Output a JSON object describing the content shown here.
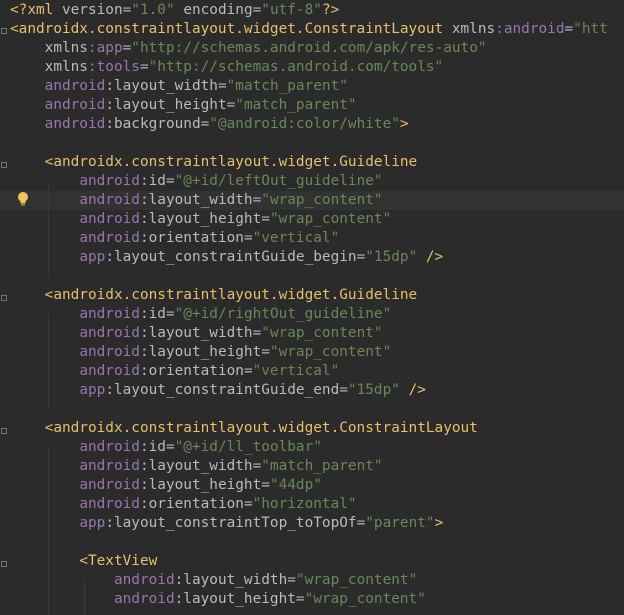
{
  "editor": {
    "lines": [
      {
        "text": "<?xml version=\"1.0\" encoding=\"utf-8\"?>",
        "segments": [
          [
            "pi",
            "<?xml "
          ],
          [
            "att",
            "version"
          ],
          [
            "pun",
            "="
          ],
          [
            "val",
            "\"1.0\""
          ],
          [
            "pun",
            " "
          ],
          [
            "att",
            "encoding"
          ],
          [
            "pun",
            "="
          ],
          [
            "val",
            "\"utf-8\""
          ],
          [
            "pi",
            "?>"
          ]
        ]
      },
      {
        "text": "<androidx.constraintlayout.widget.ConstraintLayout xmlns:android=\"htt",
        "segments": [
          [
            "tag",
            "<androidx.constraintlayout.widget.ConstraintLayout "
          ],
          [
            "att",
            "xmlns"
          ],
          [
            "ns",
            ":android"
          ],
          [
            "pun",
            "="
          ],
          [
            "val",
            "\"htt"
          ]
        ]
      },
      {
        "text": "    xmlns:app=\"http://schemas.android.com/apk/res-auto\"",
        "segments": [
          [
            "pun",
            "    "
          ],
          [
            "att",
            "xmlns"
          ],
          [
            "ns",
            ":app"
          ],
          [
            "pun",
            "="
          ],
          [
            "val",
            "\"http://schemas.android.com/apk/res-auto\""
          ]
        ]
      },
      {
        "text": "    xmlns:tools=\"http://schemas.android.com/tools\"",
        "segments": [
          [
            "pun",
            "    "
          ],
          [
            "att",
            "xmlns"
          ],
          [
            "ns",
            ":tools"
          ],
          [
            "pun",
            "="
          ],
          [
            "val",
            "\"http://schemas.android.com/tools\""
          ]
        ]
      },
      {
        "text": "    android:layout_width=\"match_parent\"",
        "segments": [
          [
            "pun",
            "    "
          ],
          [
            "ns",
            "android"
          ],
          [
            "att",
            ":layout_width"
          ],
          [
            "pun",
            "="
          ],
          [
            "val",
            "\"match_parent\""
          ]
        ]
      },
      {
        "text": "    android:layout_height=\"match_parent\"",
        "segments": [
          [
            "pun",
            "    "
          ],
          [
            "ns",
            "android"
          ],
          [
            "att",
            ":layout_height"
          ],
          [
            "pun",
            "="
          ],
          [
            "val",
            "\"match_parent\""
          ]
        ]
      },
      {
        "text": "    android:background=\"@android:color/white\">",
        "segments": [
          [
            "pun",
            "    "
          ],
          [
            "ns",
            "android"
          ],
          [
            "att",
            ":background"
          ],
          [
            "pun",
            "="
          ],
          [
            "val",
            "\"@android:color/white\""
          ],
          [
            "tag",
            ">"
          ]
        ]
      },
      {
        "text": "",
        "segments": []
      },
      {
        "text": "    <androidx.constraintlayout.widget.Guideline",
        "segments": [
          [
            "pun",
            "    "
          ],
          [
            "tag",
            "<androidx.constraintlayout.widget.Guideline"
          ]
        ]
      },
      {
        "text": "        android:id=\"@+id/leftOut_guideline\"",
        "segments": [
          [
            "pun",
            "        "
          ],
          [
            "ns",
            "android"
          ],
          [
            "att",
            ":id"
          ],
          [
            "pun",
            "="
          ],
          [
            "val",
            "\"@+id/leftOut_guideline\""
          ]
        ]
      },
      {
        "text": "        android:layout_width=\"wrap_content\"",
        "segments": [
          [
            "pun",
            "        "
          ],
          [
            "ns",
            "android"
          ],
          [
            "att",
            ":layout_width"
          ],
          [
            "pun",
            "="
          ],
          [
            "val",
            "\"wrap_content\""
          ]
        ]
      },
      {
        "text": "        android:layout_height=\"wrap_content\"",
        "segments": [
          [
            "pun",
            "        "
          ],
          [
            "ns",
            "android"
          ],
          [
            "att",
            ":layout_height"
          ],
          [
            "pun",
            "="
          ],
          [
            "val",
            "\"wrap_content\""
          ]
        ]
      },
      {
        "text": "        android:orientation=\"vertical\"",
        "segments": [
          [
            "pun",
            "        "
          ],
          [
            "ns",
            "android"
          ],
          [
            "att",
            ":orientation"
          ],
          [
            "pun",
            "="
          ],
          [
            "val",
            "\"vertical\""
          ]
        ]
      },
      {
        "text": "        app:layout_constraintGuide_begin=\"15dp\" />",
        "segments": [
          [
            "pun",
            "        "
          ],
          [
            "ns",
            "app"
          ],
          [
            "att",
            ":layout_constraintGuide_begin"
          ],
          [
            "pun",
            "="
          ],
          [
            "val",
            "\"15dp\""
          ],
          [
            "tag",
            " />"
          ]
        ]
      },
      {
        "text": "",
        "segments": []
      },
      {
        "text": "    <androidx.constraintlayout.widget.Guideline",
        "segments": [
          [
            "pun",
            "    "
          ],
          [
            "tag",
            "<androidx.constraintlayout.widget.Guideline"
          ]
        ]
      },
      {
        "text": "        android:id=\"@+id/rightOut_guideline\"",
        "segments": [
          [
            "pun",
            "        "
          ],
          [
            "ns",
            "android"
          ],
          [
            "att",
            ":id"
          ],
          [
            "pun",
            "="
          ],
          [
            "val",
            "\"@+id/rightOut_guideline\""
          ]
        ]
      },
      {
        "text": "        android:layout_width=\"wrap_content\"",
        "segments": [
          [
            "pun",
            "        "
          ],
          [
            "ns",
            "android"
          ],
          [
            "att",
            ":layout_width"
          ],
          [
            "pun",
            "="
          ],
          [
            "val",
            "\"wrap_content\""
          ]
        ]
      },
      {
        "text": "        android:layout_height=\"wrap_content\"",
        "segments": [
          [
            "pun",
            "        "
          ],
          [
            "ns",
            "android"
          ],
          [
            "att",
            ":layout_height"
          ],
          [
            "pun",
            "="
          ],
          [
            "val",
            "\"wrap_content\""
          ]
        ]
      },
      {
        "text": "        android:orientation=\"vertical\"",
        "segments": [
          [
            "pun",
            "        "
          ],
          [
            "ns",
            "android"
          ],
          [
            "att",
            ":orientation"
          ],
          [
            "pun",
            "="
          ],
          [
            "val",
            "\"vertical\""
          ]
        ]
      },
      {
        "text": "        app:layout_constraintGuide_end=\"15dp\" />",
        "segments": [
          [
            "pun",
            "        "
          ],
          [
            "ns",
            "app"
          ],
          [
            "att",
            ":layout_constraintGuide_end"
          ],
          [
            "pun",
            "="
          ],
          [
            "val",
            "\"15dp\""
          ],
          [
            "tag",
            " />"
          ]
        ]
      },
      {
        "text": "",
        "segments": []
      },
      {
        "text": "    <androidx.constraintlayout.widget.ConstraintLayout",
        "segments": [
          [
            "pun",
            "    "
          ],
          [
            "tag",
            "<androidx.constraintlayout.widget.ConstraintLayout"
          ]
        ]
      },
      {
        "text": "        android:id=\"@+id/ll_toolbar\"",
        "segments": [
          [
            "pun",
            "        "
          ],
          [
            "ns",
            "android"
          ],
          [
            "att",
            ":id"
          ],
          [
            "pun",
            "="
          ],
          [
            "val",
            "\"@+id/ll_toolbar\""
          ]
        ]
      },
      {
        "text": "        android:layout_width=\"match_parent\"",
        "segments": [
          [
            "pun",
            "        "
          ],
          [
            "ns",
            "android"
          ],
          [
            "att",
            ":layout_width"
          ],
          [
            "pun",
            "="
          ],
          [
            "val",
            "\"match_parent\""
          ]
        ]
      },
      {
        "text": "        android:layout_height=\"44dp\"",
        "segments": [
          [
            "pun",
            "        "
          ],
          [
            "ns",
            "android"
          ],
          [
            "att",
            ":layout_height"
          ],
          [
            "pun",
            "="
          ],
          [
            "val",
            "\"44dp\""
          ]
        ]
      },
      {
        "text": "        android:orientation=\"horizontal\"",
        "segments": [
          [
            "pun",
            "        "
          ],
          [
            "ns",
            "android"
          ],
          [
            "att",
            ":orientation"
          ],
          [
            "pun",
            "="
          ],
          [
            "val",
            "\"horizontal\""
          ]
        ]
      },
      {
        "text": "        app:layout_constraintTop_toTopOf=\"parent\">",
        "segments": [
          [
            "pun",
            "        "
          ],
          [
            "ns",
            "app"
          ],
          [
            "att",
            ":layout_constraintTop_toTopOf"
          ],
          [
            "pun",
            "="
          ],
          [
            "val",
            "\"parent\""
          ],
          [
            "tag",
            ">"
          ]
        ]
      },
      {
        "text": "",
        "segments": []
      },
      {
        "text": "        <TextView",
        "segments": [
          [
            "pun",
            "        "
          ],
          [
            "tag",
            "<TextView"
          ]
        ]
      },
      {
        "text": "            android:layout_width=\"wrap_content\"",
        "segments": [
          [
            "pun",
            "            "
          ],
          [
            "ns",
            "android"
          ],
          [
            "att",
            ":layout_width"
          ],
          [
            "pun",
            "="
          ],
          [
            "val",
            "\"wrap_content\""
          ]
        ]
      },
      {
        "text": "            android:layout_height=\"wrap_content\"",
        "segments": [
          [
            "pun",
            "            "
          ],
          [
            "ns",
            "android"
          ],
          [
            "att",
            ":layout_height"
          ],
          [
            "pun",
            "="
          ],
          [
            "val",
            "\"wrap_content\""
          ]
        ]
      }
    ],
    "caret_line_index": 10,
    "intention_icon": "lightbulb-icon",
    "colors": {
      "background": "#2b2b2b",
      "caret_line": "#323232",
      "tag": "#e8bf6a",
      "namespace": "#9876aa",
      "attribute": "#bababa",
      "value": "#6a8759",
      "text": "#a9b7c6"
    }
  }
}
